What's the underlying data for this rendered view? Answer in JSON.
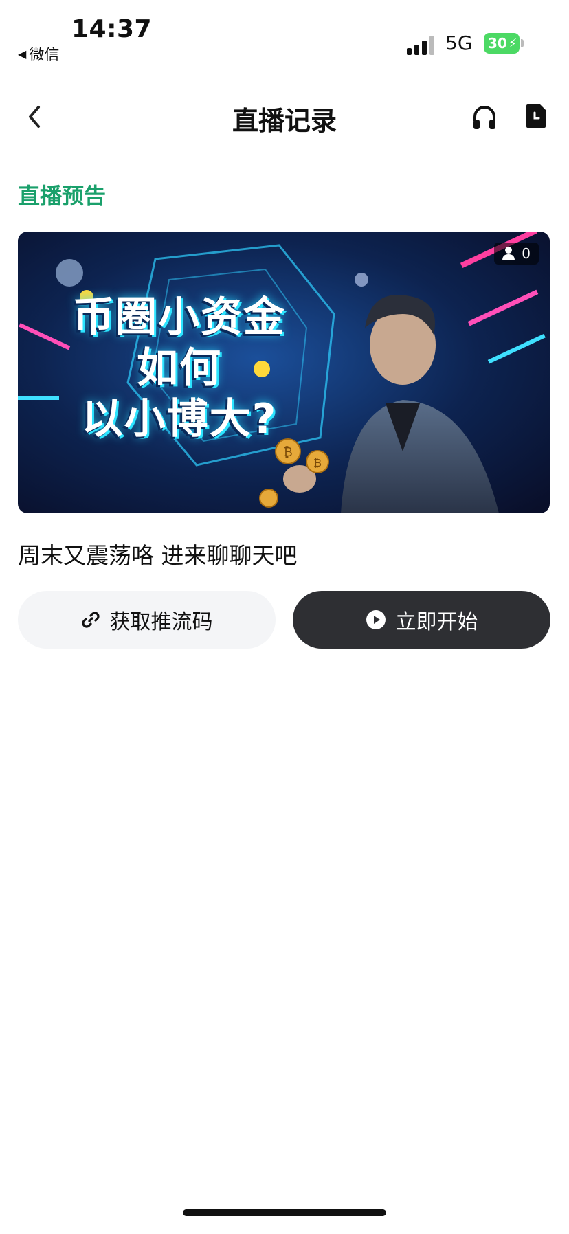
{
  "status_bar": {
    "time": "14:37",
    "back_app": "微信",
    "network": "5G",
    "battery": "30"
  },
  "nav": {
    "title": "直播记录",
    "back_icon": "chevron-left-icon",
    "headset_icon": "headset-icon",
    "doc_icon": "document-clock-icon"
  },
  "section": {
    "title": "直播预告"
  },
  "live_card": {
    "banner_title_lines": [
      "币圈小资金",
      "如何",
      "以小博大?"
    ],
    "viewer_count": "0",
    "description": "周末又震荡咯 进来聊聊天吧"
  },
  "buttons": {
    "get_stream_code": "获取推流码",
    "start_now": "立即开始"
  },
  "colors": {
    "accent_green": "#1aa06b",
    "dark_button": "#2e2f33",
    "light_button": "#f4f5f7"
  }
}
